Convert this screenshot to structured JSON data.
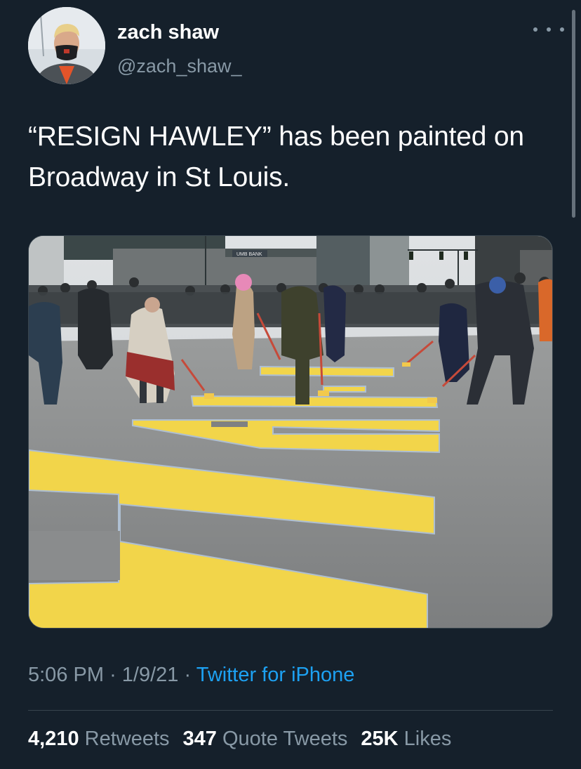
{
  "tweet": {
    "author": {
      "name": "zach shaw",
      "handle": "@zach_shaw_"
    },
    "text": "“RESIGN HAWLEY” has been painted on Broadway in St Louis.",
    "media": {
      "bank_sign": "UMB BANK"
    },
    "meta": {
      "time": "5:06 PM",
      "separator": "·",
      "date": "1/9/21",
      "source": "Twitter for iPhone"
    },
    "stats": {
      "retweets_count": "4,210",
      "retweets_label": "Retweets",
      "quote_count": "347",
      "quote_label": "Quote Tweets",
      "likes_count": "25K",
      "likes_label": "Likes"
    }
  },
  "colors": {
    "background": "#15202b",
    "secondary_text": "#8899a6",
    "link": "#1da1f2",
    "paint": "#f2d54a"
  }
}
